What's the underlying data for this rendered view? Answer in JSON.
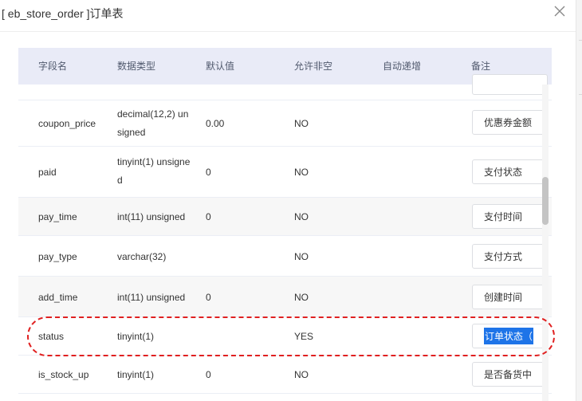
{
  "dialog": {
    "title": "[ eb_store_order ]订单表",
    "close_icon": "close-icon"
  },
  "table": {
    "headers": [
      "字段名",
      "数据类型",
      "默认值",
      "允许非空",
      "自动递增",
      "备注"
    ],
    "rows": [
      {
        "field": "",
        "type": "",
        "default": "",
        "nullable": "",
        "auto": "",
        "note": ""
      },
      {
        "field": "coupon_price",
        "type": "decimal(12,2) unsigned",
        "default": "0.00",
        "nullable": "NO",
        "auto": "",
        "note": "优惠券金额"
      },
      {
        "field": "paid",
        "type": "tinyint(1) unsigned",
        "default": "0",
        "nullable": "NO",
        "auto": "",
        "note": "支付状态"
      },
      {
        "field": "pay_time",
        "type": "int(11) unsigned",
        "default": "0",
        "nullable": "NO",
        "auto": "",
        "note": "支付时间"
      },
      {
        "field": "pay_type",
        "type": "varchar(32)",
        "default": "",
        "nullable": "NO",
        "auto": "",
        "note": "支付方式"
      },
      {
        "field": "add_time",
        "type": "int(11) unsigned",
        "default": "0",
        "nullable": "NO",
        "auto": "",
        "note": "创建时间"
      },
      {
        "field": "status",
        "type": "tinyint(1)",
        "default": "",
        "nullable": "YES",
        "auto": "",
        "note": "订单状态（"
      },
      {
        "field": "is_stock_up",
        "type": "tinyint(1)",
        "default": "0",
        "nullable": "NO",
        "auto": "",
        "note": "是否备货中"
      }
    ]
  },
  "annotation": {
    "highlighted_row": "status"
  },
  "colors": {
    "header_bg": "#e9ebf7",
    "selection": "#1e74e8",
    "highlight": "#e02020"
  }
}
